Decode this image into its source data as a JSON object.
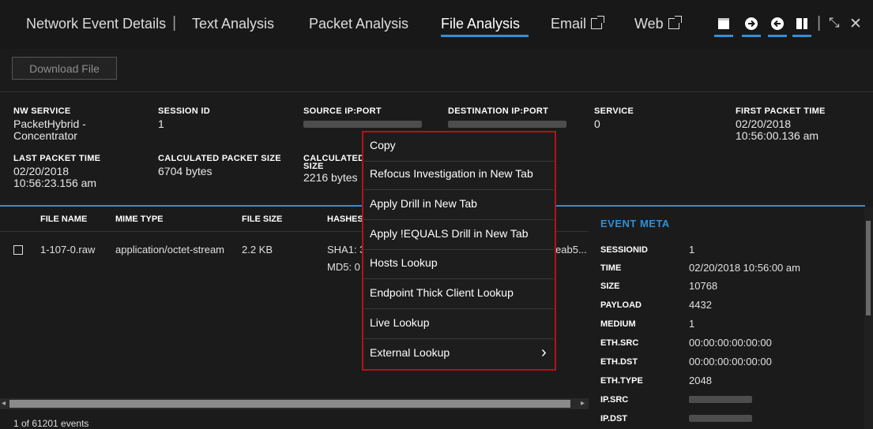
{
  "tabs": {
    "network_event_details": "Network Event Details",
    "separator": "|",
    "text_analysis": "Text Analysis",
    "packet_analysis": "Packet Analysis",
    "file_analysis": "File Analysis",
    "email": "Email",
    "web": "Web"
  },
  "toolbar": {
    "collapse_icon": "⤡",
    "close_icon": "✕"
  },
  "download_button": "Download File",
  "meta": {
    "nw_service_label": "NW SERVICE",
    "nw_service_value": "PacketHybrid - Concentrator",
    "session_id_label": "SESSION ID",
    "session_id_value": "1",
    "source_ip_label": "SOURCE IP:PORT",
    "destination_ip_label": "DESTINATION IP:PORT",
    "service_label": "SERVICE",
    "service_value": "0",
    "first_packet_label": "FIRST PACKET TIME",
    "first_packet_value_line1": "02/20/2018",
    "first_packet_value_line2": "10:56:00.136 am",
    "last_packet_label": "LAST PACKET TIME",
    "last_packet_value_line1": "02/20/2018",
    "last_packet_value_line2": "10:56:23.156 am",
    "calc_packet_size_label": "CALCULATED PACKET SIZE",
    "calc_packet_size_value": "6704 bytes",
    "calculated_label_line1": "CALCULATED",
    "calculated_label_line2": "SIZE",
    "calculated_value": "2216 bytes"
  },
  "table": {
    "headers": {
      "file_name": "FILE NAME",
      "mime_type": "MIME TYPE",
      "file_size": "FILE SIZE",
      "hashes": "HASHES"
    },
    "row": {
      "file_name": "1-107-0.raw",
      "mime_type": "application/octet-stream",
      "file_size": "2.2 KB",
      "sha1": "SHA1: 3",
      "md5": "MD5: 0",
      "hash_tail": "eab5..."
    }
  },
  "event_meta": {
    "title": "EVENT META",
    "rows": [
      {
        "key": "SESSIONID",
        "value": "1"
      },
      {
        "key": "TIME",
        "value": "02/20/2018 10:56:00 am"
      },
      {
        "key": "SIZE",
        "value": "10768"
      },
      {
        "key": "PAYLOAD",
        "value": "4432"
      },
      {
        "key": "MEDIUM",
        "value": "1"
      },
      {
        "key": "ETH.SRC",
        "value": "00:00:00:00:00:00"
      },
      {
        "key": "ETH.DST",
        "value": "00:00:00:00:00:00"
      },
      {
        "key": "ETH.TYPE",
        "value": "2048"
      },
      {
        "key": "IP.SRC",
        "value": ""
      },
      {
        "key": "IP.DST",
        "value": ""
      }
    ]
  },
  "context_menu": {
    "items": [
      "Copy",
      "Refocus Investigation in New Tab",
      "Apply Drill in New Tab",
      "Apply !EQUALS Drill in New Tab",
      "Hosts Lookup",
      "Endpoint Thick Client Lookup",
      "Live Lookup",
      "External Lookup"
    ],
    "submenu_arrow": "›"
  },
  "footer": {
    "events_count": "1 of 61201 events"
  },
  "colors": {
    "accent": "#2f8fd8",
    "menu_border": "#b5121b",
    "background": "#1b1b1b"
  }
}
